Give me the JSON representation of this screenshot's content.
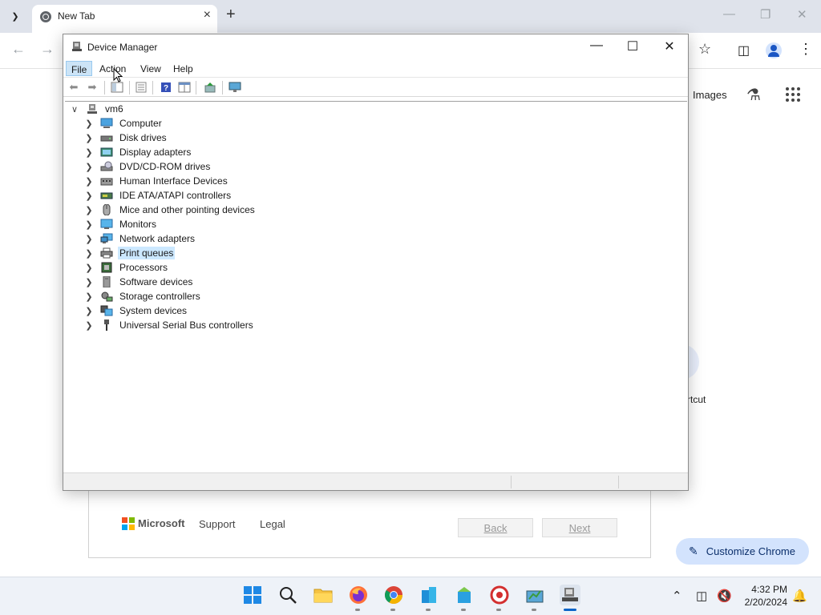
{
  "browser": {
    "tab_title": "New Tab",
    "images_link": "Images",
    "shortcut_label": "rtcut",
    "customize_label": "Customize Chrome",
    "footer": {
      "brand": "Microsoft",
      "support": "Support",
      "legal": "Legal",
      "back": "Back",
      "next": "Next"
    }
  },
  "device_manager": {
    "title": "Device Manager",
    "menu": [
      "File",
      "Action",
      "View",
      "Help"
    ],
    "root": "vm6",
    "categories": [
      "Computer",
      "Disk drives",
      "Display adapters",
      "DVD/CD-ROM drives",
      "Human Interface Devices",
      "IDE ATA/ATAPI controllers",
      "Mice and other pointing devices",
      "Monitors",
      "Network adapters",
      "Print queues",
      "Processors",
      "Software devices",
      "Storage controllers",
      "System devices",
      "Universal Serial Bus controllers"
    ],
    "selected_category": "Print queues"
  },
  "taskbar": {
    "time": "4:32 PM",
    "date": "2/20/2024"
  },
  "colors": {
    "accent": "#0a64c8",
    "selection": "#cce8ff",
    "menu_active": "#cce4f7",
    "tabstrip": "#dfe3eb",
    "customize_bg": "#d3e3fd"
  }
}
